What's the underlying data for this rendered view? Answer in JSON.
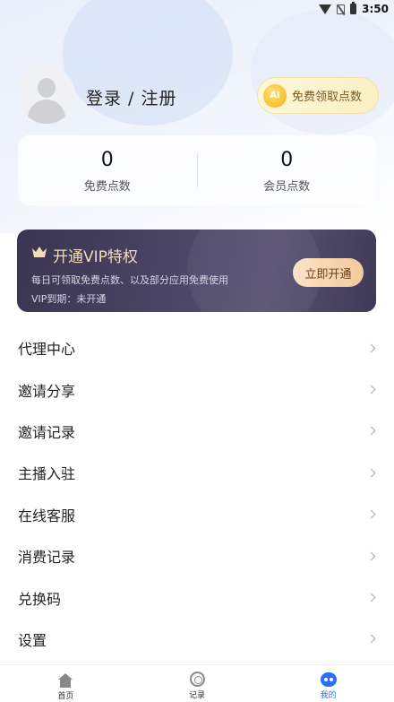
{
  "status_bar": {
    "time": "3:50"
  },
  "profile": {
    "login_label": "登录 / 注册",
    "free_points_button": "免费领取点数",
    "ai_badge": "AI"
  },
  "points": [
    {
      "value": "0",
      "label": "免费点数"
    },
    {
      "value": "0",
      "label": "会员点数"
    }
  ],
  "vip": {
    "title": "开通VIP特权",
    "description": "每日可领取免费点数、以及部分应用免费使用",
    "expire": "VIP到期：未开通",
    "button": "立即开通"
  },
  "menu": [
    {
      "label": "代理中心"
    },
    {
      "label": "邀请分享"
    },
    {
      "label": "邀请记录"
    },
    {
      "label": "主播入驻"
    },
    {
      "label": "在线客服"
    },
    {
      "label": "消费记录"
    },
    {
      "label": "兑换码"
    },
    {
      "label": "设置"
    }
  ],
  "tabs": [
    {
      "label": "首页",
      "icon": "home-icon"
    },
    {
      "label": "记录",
      "icon": "record-icon"
    },
    {
      "label": "我的",
      "icon": "mine-icon"
    }
  ],
  "colors": {
    "accent": "#2e6bff",
    "vip_gold": "#f3dcb8"
  }
}
